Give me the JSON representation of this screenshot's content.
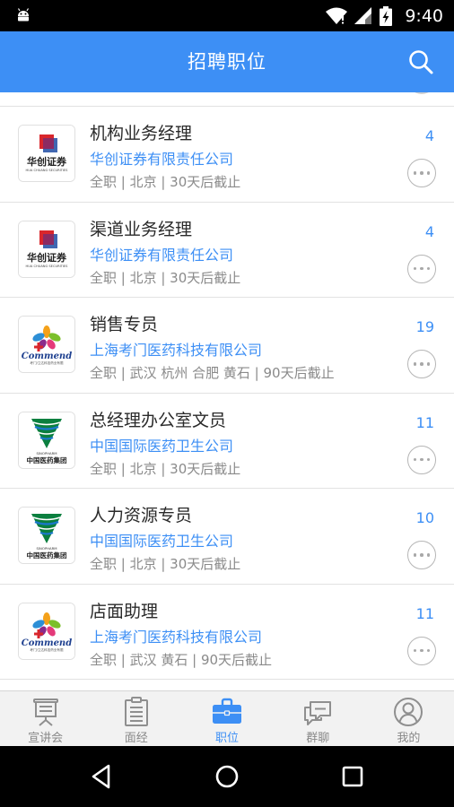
{
  "status_bar": {
    "time": "9:40",
    "icons": [
      "android-icon",
      "wifi-icon",
      "signal-icon",
      "battery-icon"
    ]
  },
  "app_bar": {
    "title": "招聘职位",
    "search_icon": "search-icon",
    "color": "#3d8ff5"
  },
  "jobs": [
    {
      "title": "机构业务经理",
      "company": "华创证券有限责任公司",
      "meta": "全职 | 北京 | 30天后截止",
      "count": "4",
      "logo": "huachuang"
    },
    {
      "title": "渠道业务经理",
      "company": "华创证券有限责任公司",
      "meta": "全职 | 北京 | 30天后截止",
      "count": "4",
      "logo": "huachuang"
    },
    {
      "title": "销售专员",
      "company": "上海考门医药科技有限公司",
      "meta": "全职 | 武汉 杭州 合肥 黄石 | 90天后截止",
      "count": "19",
      "logo": "commend"
    },
    {
      "title": "总经理办公室文员",
      "company": "中国国际医药卫生公司",
      "meta": "全职 | 北京 | 30天后截止",
      "count": "11",
      "logo": "sinopharm"
    },
    {
      "title": "人力资源专员",
      "company": "中国国际医药卫生公司",
      "meta": "全职 | 北京 | 30天后截止",
      "count": "10",
      "logo": "sinopharm"
    },
    {
      "title": "店面助理",
      "company": "上海考门医药科技有限公司",
      "meta": "全职 | 武汉 黄石 | 90天后截止",
      "count": "11",
      "logo": "commend"
    }
  ],
  "logos": {
    "huachuang": {
      "text": "华创证券",
      "sub": "HUA CHUANG SECURITIES"
    },
    "commend": {
      "text": "Commend",
      "sub": "考门/立达科技药业有限"
    },
    "sinopharm": {
      "text": "中国医药集团",
      "sub": "SINOPHARM"
    }
  },
  "bottom_nav": {
    "items": [
      {
        "label": "宣讲会",
        "icon": "presentation-board-icon",
        "active": false
      },
      {
        "label": "面经",
        "icon": "notes-clipboard-icon",
        "active": false
      },
      {
        "label": "职位",
        "icon": "briefcase-icon",
        "active": true
      },
      {
        "label": "群聊",
        "icon": "chat-bubbles-icon",
        "active": false
      },
      {
        "label": "我的",
        "icon": "profile-icon",
        "active": false
      }
    ],
    "active_color": "#3d8ff5"
  },
  "system_nav": [
    "back-icon",
    "home-icon",
    "recents-icon"
  ]
}
